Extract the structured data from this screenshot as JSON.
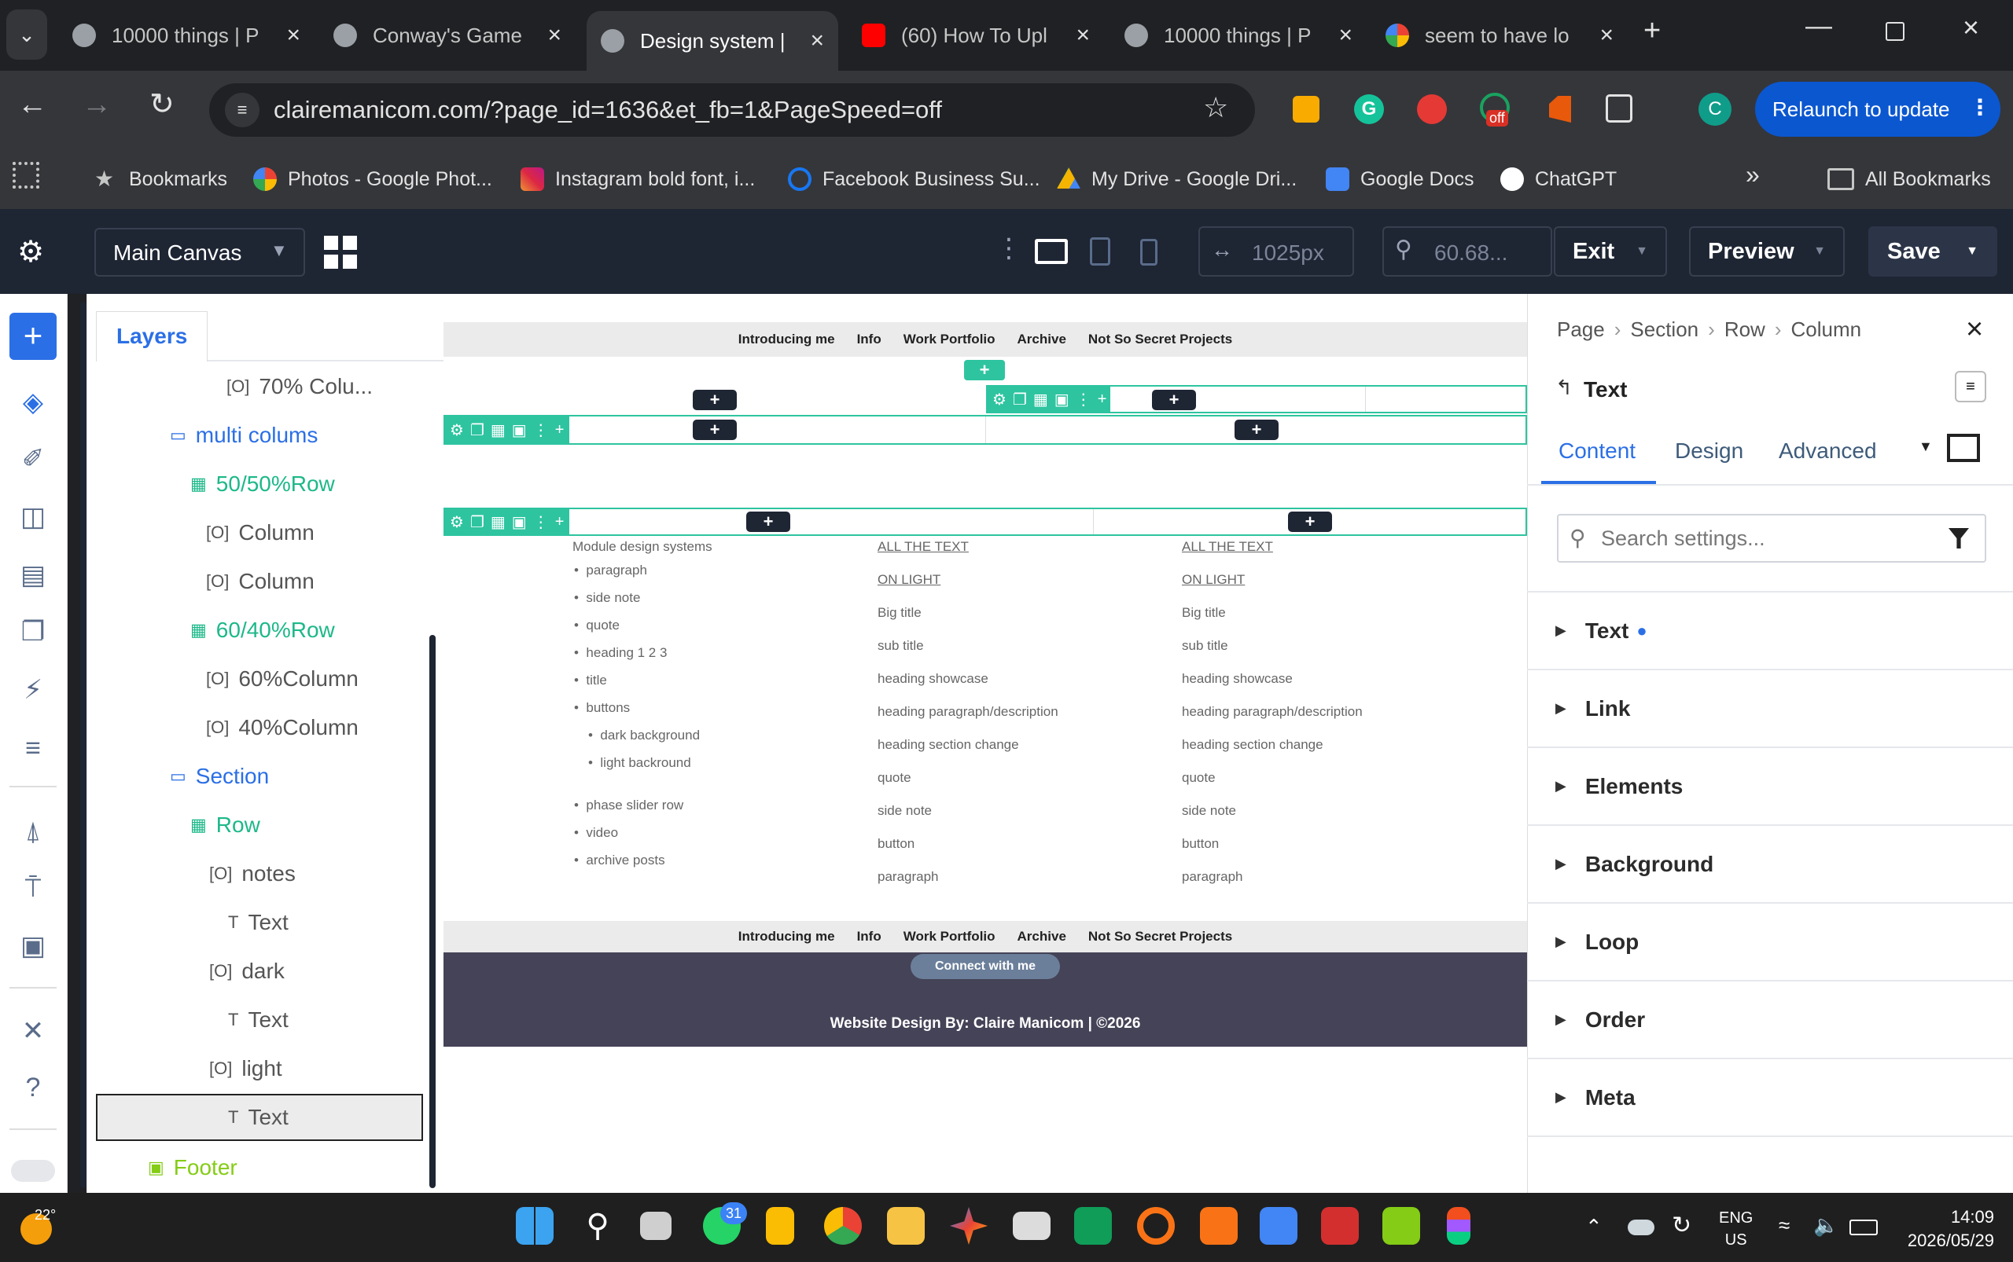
{
  "browser": {
    "tabs": [
      {
        "title": "10000 things | P",
        "active": false
      },
      {
        "title": "Conway's Game",
        "active": false
      },
      {
        "title": "Design system |",
        "active": true
      },
      {
        "title": "(60) How To Upl",
        "active": false
      },
      {
        "title": "10000 things | P",
        "active": false
      },
      {
        "title": "seem to have lo",
        "active": false
      }
    ],
    "url": "clairemanicom.com/?page_id=1636&et_fb=1&PageSpeed=off",
    "relaunch_label": "Relaunch to update",
    "profile_initial": "C",
    "ext_badge": "off",
    "bookmarks": [
      "Bookmarks",
      "Photos - Google Phot...",
      "Instagram bold font, i...",
      "Facebook Business Su...",
      "My Drive - Google Dri...",
      "Google Docs",
      "ChatGPT"
    ],
    "all_bookmarks": "All Bookmarks"
  },
  "builder": {
    "canvas_select": "Main Canvas",
    "width_value": "1025px",
    "zoom_value": "60.68...",
    "exit_label": "Exit",
    "preview_label": "Preview",
    "save_label": "Save"
  },
  "layers": {
    "tab_label": "Layers",
    "items": [
      {
        "label": "70% Colu...",
        "type": "column"
      },
      {
        "label": "multi colums",
        "type": "section"
      },
      {
        "label": "50/50%Row",
        "type": "row"
      },
      {
        "label": "Column",
        "type": "column"
      },
      {
        "label": "Column",
        "type": "column"
      },
      {
        "label": "60/40%Row",
        "type": "row"
      },
      {
        "label": "60%Column",
        "type": "column"
      },
      {
        "label": "40%Column",
        "type": "column"
      },
      {
        "label": "Section",
        "type": "section"
      },
      {
        "label": "Row",
        "type": "row"
      },
      {
        "label": "notes",
        "type": "column"
      },
      {
        "label": "Text",
        "type": "text"
      },
      {
        "label": "dark",
        "type": "column"
      },
      {
        "label": "Text",
        "type": "text"
      },
      {
        "label": "light",
        "type": "column"
      },
      {
        "label": "Text",
        "type": "text",
        "selected": true
      },
      {
        "label": "Footer",
        "type": "footer"
      }
    ]
  },
  "canvas": {
    "nav": [
      "Introducing me",
      "Info",
      "Work Portfolio",
      "Archive",
      "Not So Secret Projects"
    ],
    "col1_heading": "Module design systems",
    "col1_items": [
      "paragraph",
      "side note",
      "quote",
      "heading 1 2 3",
      "title",
      "buttons",
      "dark background",
      "light backround",
      "phase slider row",
      "video",
      "archive posts"
    ],
    "col_items": [
      "ALL THE TEXT",
      "ON LIGHT",
      "Big title",
      "sub title",
      "heading showcase",
      "heading paragraph/description",
      "heading section change",
      "quote",
      "side note",
      "button",
      "paragraph"
    ],
    "col3_items": [
      "ALL THE TEXT",
      "ON LIGHT",
      "Big title",
      "sub title",
      "heading showcase",
      "heading paragraph/description",
      "heading section change",
      "quote",
      "side note",
      "button",
      "paragraph"
    ],
    "footer_nav": [
      "Introducing me",
      "Info",
      "Work Portfolio",
      "Archive",
      "Not So Secret Projects"
    ],
    "connect_button": "Connect with me",
    "credit": "Website Design By: Claire Manicom | ©2026"
  },
  "settings": {
    "breadcrumb": [
      "Page",
      "Section",
      "Row",
      "Column"
    ],
    "element_title": "Text",
    "tabs": [
      "Content",
      "Design",
      "Advanced"
    ],
    "active_tab": "Content",
    "search_placeholder": "Search settings...",
    "sections": [
      "Text",
      "Link",
      "Elements",
      "Background",
      "Loop",
      "Order",
      "Meta"
    ]
  },
  "taskbar": {
    "weather": "22°",
    "chat_badge": "31",
    "lang1": "ENG",
    "lang2": "US",
    "time": "14:09",
    "date": "2026/05/29"
  },
  "colors": {
    "accent": "#2ec4a0",
    "builder_blue": "#2b6fe6",
    "dark": "#1e2533"
  }
}
